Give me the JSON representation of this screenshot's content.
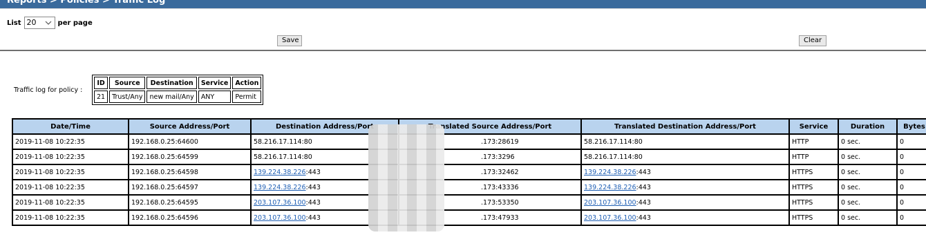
{
  "breadcrumb": "Reports > Policies > Traffic Log",
  "list": {
    "label": "List",
    "value": "20",
    "suffix": "per page"
  },
  "buttons": {
    "save": "Save",
    "clear": "Clear"
  },
  "policy": {
    "label": "Traffic log for policy :",
    "headers": [
      "ID",
      "Source",
      "Destination",
      "Service",
      "Action"
    ],
    "row": [
      "21",
      "Trust/Any",
      "new mail/Any",
      "ANY",
      "Permit"
    ]
  },
  "log": {
    "headers": [
      "Date/Time",
      "Source Address/Port",
      "Destination Address/Port",
      "Translated Source Address/Port",
      "Translated Destination Address/Port",
      "Service",
      "Duration",
      "Bytes"
    ],
    "rows": [
      {
        "datetime": "2019-11-08 10:22:35",
        "src": "192.168.0.25:64600",
        "dst_ip": "58.216.17.114",
        "dst_port": ":80",
        "dst_link": false,
        "tsrc": ".173:28619",
        "tdst_ip": "58.216.17.114",
        "tdst_port": ":80",
        "tdst_link": false,
        "service": "HTTP",
        "duration": "0 sec.",
        "bytes": "0"
      },
      {
        "datetime": "2019-11-08 10:22:35",
        "src": "192.168.0.25:64599",
        "dst_ip": "58.216.17.114",
        "dst_port": ":80",
        "dst_link": false,
        "tsrc": ".173:3296",
        "tdst_ip": "58.216.17.114",
        "tdst_port": ":80",
        "tdst_link": false,
        "service": "HTTP",
        "duration": "0 sec.",
        "bytes": "0"
      },
      {
        "datetime": "2019-11-08 10:22:35",
        "src": "192.168.0.25:64598",
        "dst_ip": "139.224.38.226",
        "dst_port": ":443",
        "dst_link": true,
        "tsrc": ".173:32462",
        "tdst_ip": "139.224.38.226",
        "tdst_port": ":443",
        "tdst_link": true,
        "service": "HTTPS",
        "duration": "0 sec.",
        "bytes": "0"
      },
      {
        "datetime": "2019-11-08 10:22:35",
        "src": "192.168.0.25:64597",
        "dst_ip": "139.224.38.226",
        "dst_port": ":443",
        "dst_link": true,
        "tsrc": ".173:43336",
        "tdst_ip": "139.224.38.226",
        "tdst_port": ":443",
        "tdst_link": true,
        "service": "HTTPS",
        "duration": "0 sec.",
        "bytes": "0"
      },
      {
        "datetime": "2019-11-08 10:22:35",
        "src": "192.168.0.25:64595",
        "dst_ip": "203.107.36.100",
        "dst_port": ":443",
        "dst_link": true,
        "tsrc": ".173:53350",
        "tdst_ip": "203.107.36.100",
        "tdst_port": ":443",
        "tdst_link": true,
        "service": "HTTPS",
        "duration": "0 sec.",
        "bytes": "0"
      },
      {
        "datetime": "2019-11-08 10:22:35",
        "src": "192.168.0.25:64596",
        "dst_ip": "203.107.36.100",
        "dst_port": ":443",
        "dst_link": true,
        "tsrc": ".173:47933",
        "tdst_ip": "203.107.36.100",
        "tdst_port": ":443",
        "tdst_link": true,
        "service": "HTTPS",
        "duration": "0 sec.",
        "bytes": "0"
      }
    ]
  },
  "colors": {
    "header_bar": "#3a6a9c",
    "table_header": "#b9d3ee",
    "link": "#1f5fb4"
  },
  "icons": {
    "select": "chevron-down-icon"
  }
}
